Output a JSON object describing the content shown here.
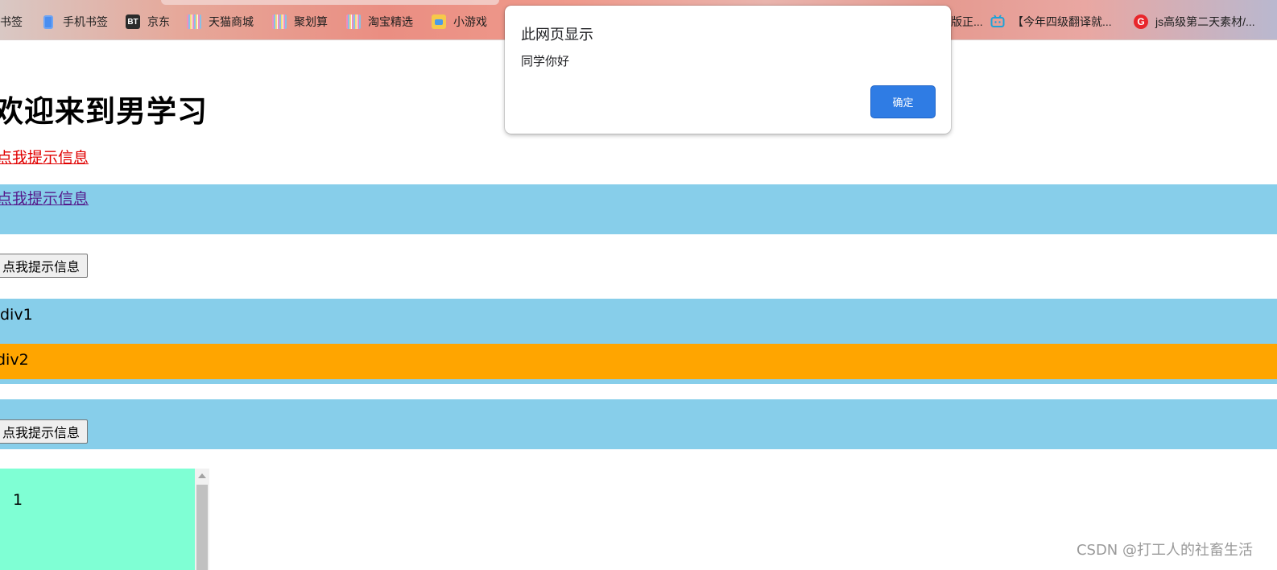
{
  "bookmarks": [
    {
      "label": "书签",
      "icon": "none"
    },
    {
      "label": "手机书签",
      "icon": "phone-icon"
    },
    {
      "label": "京东",
      "icon": "bt-icon",
      "icon_text": "BT"
    },
    {
      "label": "天猫商城",
      "icon": "pattern-icon"
    },
    {
      "label": "聚划算",
      "icon": "pattern-icon"
    },
    {
      "label": "淘宝精选",
      "icon": "pattern-icon"
    },
    {
      "label": "小游戏",
      "icon": "game-icon"
    },
    {
      "label": "版正...",
      "icon": "none"
    },
    {
      "label": "【今年四级翻译就...",
      "icon": "bilibili-tv-icon",
      "icon_text": "📺"
    },
    {
      "label": "js高级第二天素材/...",
      "icon": "g-logo-icon",
      "icon_text": "G"
    }
  ],
  "page": {
    "heading": "欢迎来到男学习",
    "link_red": "点我提示信息",
    "link_purple": "点我提示信息",
    "button_1": "点我提示信息",
    "div1": "div1",
    "div2": "div2",
    "button_2": "点我提示信息",
    "scroll_box_value": "1",
    "watermark": "CSDN @打工人的社畜生活"
  },
  "colors": {
    "sky_band": "#87ceea",
    "orange_band": "#ffa500",
    "aquamarine_box": "#7fffd4",
    "link_red": "#e00000",
    "link_visited": "#551a8b",
    "dialog_button": "#2f7ce4"
  },
  "dialog": {
    "title": "此网页显示",
    "message": "同学你好",
    "ok_label": "确定"
  }
}
